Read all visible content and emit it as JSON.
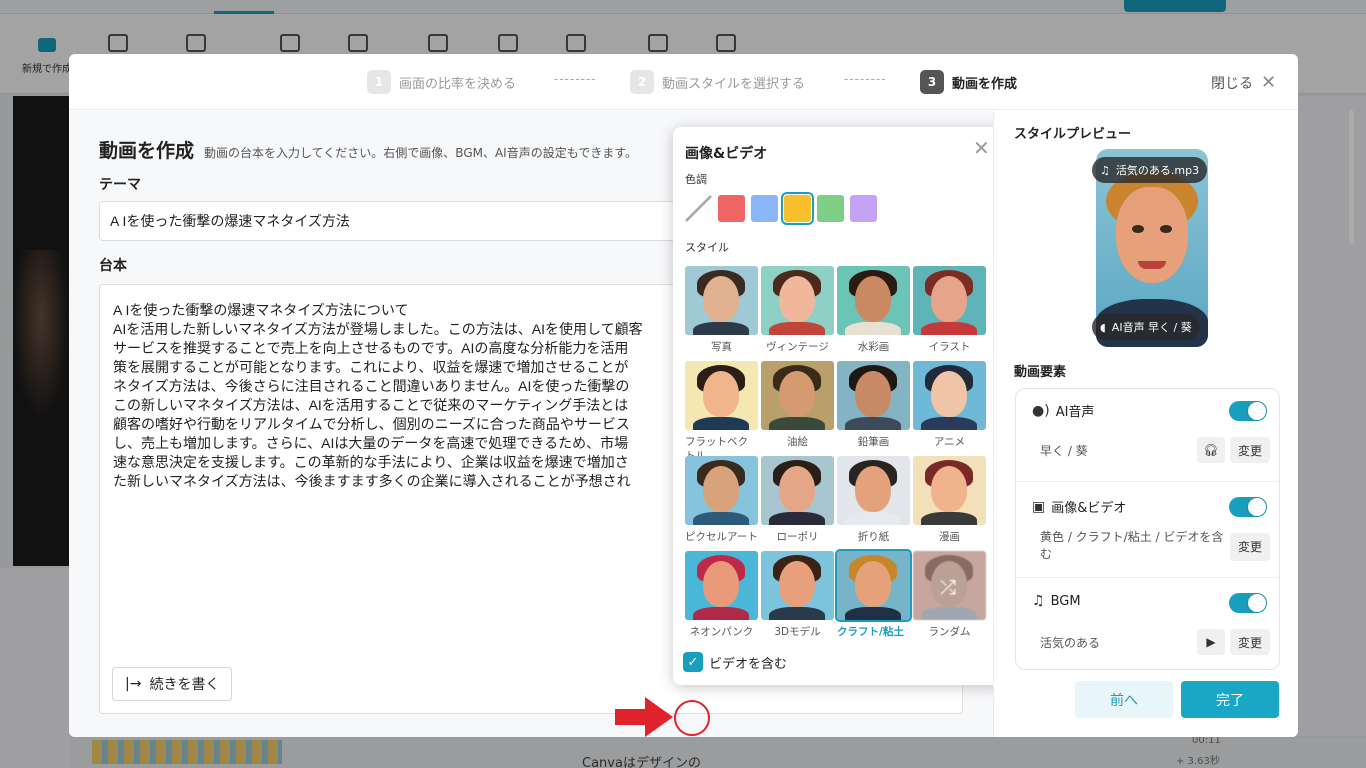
{
  "stepper": {
    "steps": [
      {
        "num": "1",
        "label": "画面の比率を決める"
      },
      {
        "num": "2",
        "label": "動画スタイルを選択する"
      },
      {
        "num": "3",
        "label": "動画を作成"
      }
    ],
    "close_label": "閉じる"
  },
  "editor": {
    "title": "動画を作成",
    "description": "動画の台本を入力してください。右側で画像、BGM、AI音声の設定もできます。",
    "theme_label": "テーマ",
    "theme_value": "A Iを使った衝撃の爆速マネタイズ方法",
    "script_label": "台本",
    "script_lines": [
      "A Iを使った衝撃の爆速マネタイズ方法について",
      "AIを活用した新しいマネタイズ方法が登場しました。この方法は、AIを使用して顧客",
      "サービスを推奨することで売上を向上させるものです。AIの高度な分析能力を活用",
      "策を展開することが可能となります。これにより、収益を爆速で増加させることが",
      "ネタイズ方法は、今後さらに注目されること間違いありません。AIを使った衝撃の",
      "この新しいマネタイズ方法は、AIを活用することで従来のマーケティング手法とは",
      "顧客の嗜好や行動をリアルタイムで分析し、個別のニーズに合った商品やサービス",
      "し、売上も増加します。さらに、AIは大量のデータを高速で処理できるため、市場",
      "速な意思決定を支援します。この革新的な手法により、企業は収益を爆速で増加さ",
      "た新しいマネタイズ方法は、今後ますます多くの企業に導入されることが予想され"
    ],
    "continue_label": "続きを書く"
  },
  "media_popup": {
    "title": "画像&ビデオ",
    "tone_label": "色調",
    "tone_swatches": [
      {
        "name": "none",
        "color": "transparent"
      },
      {
        "name": "red",
        "color": "#f06464"
      },
      {
        "name": "blue",
        "color": "#8ab6f7"
      },
      {
        "name": "yellow",
        "color": "#f7c02c",
        "selected": true
      },
      {
        "name": "green",
        "color": "#7ccf84"
      },
      {
        "name": "purple",
        "color": "#c4a3f4"
      }
    ],
    "style_label": "スタイル",
    "styles": [
      {
        "label": "写真",
        "bg": "#9fc9d4",
        "skin": "#e0b28f",
        "hair": "#3a2a22",
        "cloth": "#2d3a4a"
      },
      {
        "label": "ヴィンテージ",
        "bg": "#8fd0c6",
        "skin": "#f0b79a",
        "hair": "#4a2a1a",
        "cloth": "#c2453c"
      },
      {
        "label": "水彩画",
        "bg": "#6cc4b6",
        "skin": "#c98a63",
        "hair": "#2a1a12",
        "cloth": "#e8e0d0"
      },
      {
        "label": "イラスト",
        "bg": "#5fb4b8",
        "skin": "#e6a58a",
        "hair": "#7a2e22",
        "cloth": "#c43a3a"
      },
      {
        "label": "フラットベクトル",
        "bg": "#f4e7b2",
        "skin": "#f0b58a",
        "hair": "#2a1e16",
        "cloth": "#1e3a55"
      },
      {
        "label": "油絵",
        "bg": "#b9a06a",
        "skin": "#d49a72",
        "hair": "#3a2a18",
        "cloth": "#3a4a3a"
      },
      {
        "label": "鉛筆画",
        "bg": "#84b4c4",
        "skin": "#c88a66",
        "hair": "#1e1812",
        "cloth": "#3c4a5a"
      },
      {
        "label": "アニメ",
        "bg": "#6fb8d6",
        "skin": "#f0c4a6",
        "hair": "#222a3a",
        "cloth": "#2a3a5a"
      },
      {
        "label": "ピクセルアート",
        "bg": "#86c3dd",
        "skin": "#d8a27c",
        "hair": "#3a2a1e",
        "cloth": "#2e5a7a"
      },
      {
        "label": "ローポリ",
        "bg": "#a8c6cf",
        "skin": "#e5a688",
        "hair": "#2a1e18",
        "cloth": "#2a2a3a"
      },
      {
        "label": "折り紙",
        "bg": "#e2e5ea",
        "skin": "#e3a27c",
        "hair": "#2a2420",
        "cloth": "#e8e8f0"
      },
      {
        "label": "漫画",
        "bg": "#f2e0b8",
        "skin": "#f0b38e",
        "hair": "#7a2a26",
        "cloth": "#3a3a3a"
      },
      {
        "label": "ネオンパンク",
        "bg": "#4ab6d8",
        "skin": "#e89a7a",
        "hair": "#c02848",
        "cloth": "#b02a48"
      },
      {
        "label": "3Dモデル",
        "bg": "#7cc4dc",
        "skin": "#e8a07c",
        "hair": "#3a2216",
        "cloth": "#2a3a4a"
      },
      {
        "label": "クラフト/粘土",
        "bg": "#78b4c8",
        "skin": "#e5a27a",
        "hair": "#c8862c",
        "cloth": "#1f3048",
        "selected": true
      },
      {
        "label": "ランダム",
        "bg": "#c8a6a0",
        "skin": "#bba096",
        "hair": "#8a6a64",
        "cloth": "#9fa6b0",
        "random": true
      }
    ],
    "include_video_label": "ビデオを含む",
    "include_video_checked": true
  },
  "preview": {
    "title": "スタイルプレビュー",
    "bgm_badge": "活気のある.mp3",
    "voice_badge": "AI音声  早く / 葵"
  },
  "elements": {
    "title": "動画要素",
    "ai_voice": {
      "label": "AI音声",
      "value": "早く / 葵",
      "change": "変更",
      "enabled": true
    },
    "media": {
      "label": "画像&ビデオ",
      "value": "黄色 / クラフト/粘土 / ビデオを含む",
      "change": "変更",
      "enabled": true
    },
    "bgm": {
      "label": "BGM",
      "value": "活気のある",
      "change": "変更",
      "enabled": true
    }
  },
  "footer": {
    "prev_label": "前へ",
    "done_label": "完了"
  },
  "background": {
    "new_label": "新規で作成",
    "canva_text": "Canvaはデザインの",
    "time1": "00:11",
    "time2": "+ 3.63秒"
  },
  "colors": {
    "accent": "#1a9ebd",
    "highlight_red": "#e0222a"
  }
}
